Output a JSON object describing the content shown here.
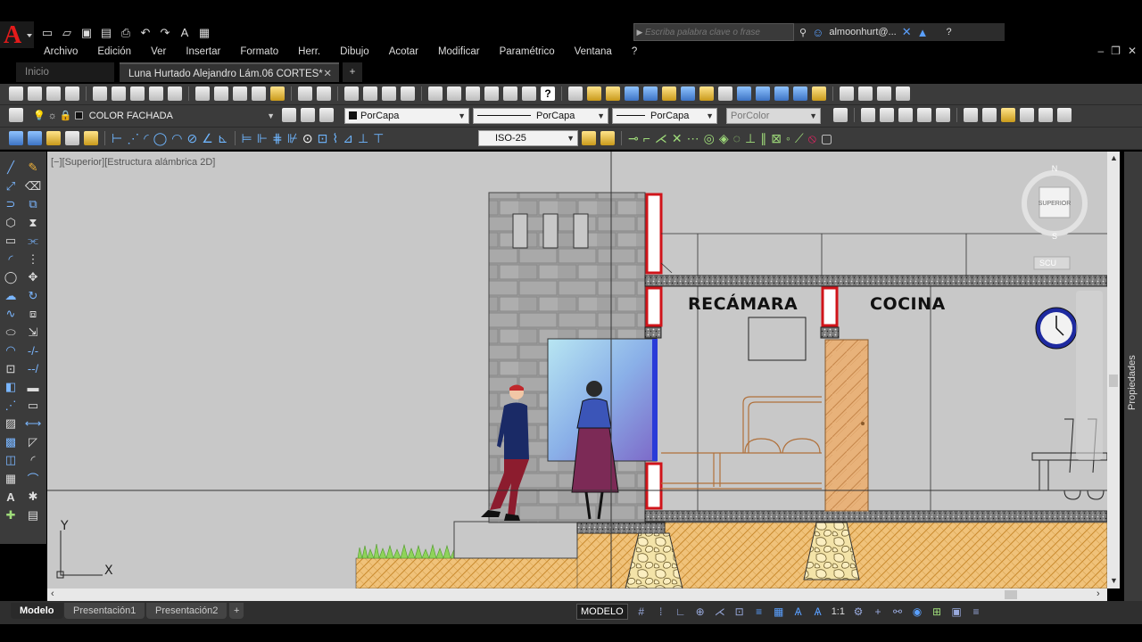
{
  "app": {
    "logo_letter": "A"
  },
  "search": {
    "placeholder": "Escriba palabra clave o frase"
  },
  "user": {
    "name": "almoonhurt@..."
  },
  "menu": [
    "Archivo",
    "Edición",
    "Ver",
    "Insertar",
    "Formato",
    "Herr.",
    "Dibujo",
    "Acotar",
    "Modificar",
    "Paramétrico",
    "Ventana",
    "?"
  ],
  "tabs": {
    "home": "Inicio",
    "file": "Luna Hurtado Alejandro Lám.06 CORTES*"
  },
  "layer": {
    "name": "COLOR FACHADA"
  },
  "properties": {
    "color": "PorCapa",
    "linetype": "PorCapa",
    "lineweight": "PorCapa",
    "plotstyle": "PorColor"
  },
  "dimstyle": {
    "name": "ISO-25"
  },
  "viewport": {
    "label": "[−][Superior][Estructura alámbrica 2D]"
  },
  "viewcube": {
    "north": "N",
    "south": "S",
    "face": "SUPERIOR",
    "ucs": "SCU"
  },
  "drawing": {
    "room1": "RECÁMARA",
    "room2": "COCINA",
    "axis_x": "X",
    "axis_y": "Y"
  },
  "properties_panel": {
    "label": "Propiedades"
  },
  "layout_tabs": {
    "model": "Modelo",
    "p1": "Presentación1",
    "p2": "Presentación2"
  },
  "status": {
    "space": "MODELO",
    "scale": "1:1"
  },
  "colors": {
    "accent_red": "#e41b1b",
    "canvas": "#c8c8c8",
    "ui_dark": "#3b3b3b"
  }
}
